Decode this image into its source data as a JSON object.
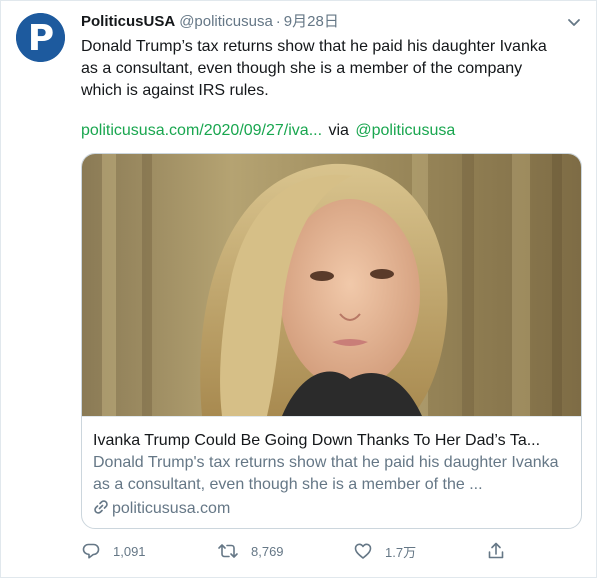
{
  "tweet": {
    "display_name": "PoliticusUSA",
    "handle": "@politicususa",
    "separator": "·",
    "date": "9月28日",
    "text": "Donald Trump’s tax returns show that he paid his daughter Ivanka as a consultant, even though she is a member of the company which is against IRS rules.",
    "link_text": "politicususa.com/2020/09/27/iva...",
    "via_text": "via",
    "via_handle": "@politicususa",
    "link_color": "#19a64f"
  },
  "card": {
    "title": "Ivanka Trump Could Be Going Down Thanks To Her Dad’s Ta...",
    "description": "Donald Trump's tax returns show that he paid his daughter Ivanka as a consultant, even though she is a member of the ...",
    "domain": "politicususa.com"
  },
  "actions": {
    "replies": "1,091",
    "retweets": "8,769",
    "likes": "1.7万",
    "share_icon": "share-icon"
  },
  "avatar_letter": "P"
}
